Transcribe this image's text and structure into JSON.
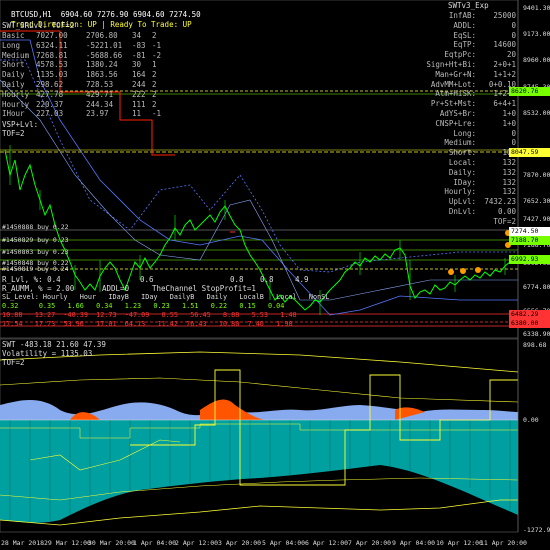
{
  "header": {
    "symbol_line": "BTCUSD,H1  6904.60 7276.90 6904.60 7274.50",
    "trend_label": "Trend Direction: ",
    "trend_value": "UP",
    "ready_label": "| Ready To Trade: ",
    "ready_value": "UP",
    "indicator_name": "SWTv3_Exp",
    "srlvl_label": "SWT_SRLvl: TOF=2"
  },
  "left_table": {
    "rows": [
      {
        "name": "Basic",
        "v1": "7027.00",
        "v2": "2706.80",
        "v3": "34",
        "v4": "2"
      },
      {
        "name": "Long",
        "v1": "6324.11",
        "v2": "-5221.01",
        "v3": "-83",
        "v4": "-1"
      },
      {
        "name": "Medium",
        "v1": "7268.81",
        "v2": "-5688.66",
        "v3": "-81",
        "v4": "-2"
      },
      {
        "name": "Short",
        "v1": "4578.53",
        "v2": "1380.24",
        "v3": "30",
        "v4": "1"
      },
      {
        "name": "Daily",
        "v1": "1135.03",
        "v2": "1863.56",
        "v3": "164",
        "v4": "2"
      },
      {
        "name": "Daily",
        "v1": "298.62",
        "v2": "728.53",
        "v3": "244",
        "v4": "2"
      },
      {
        "name": "Hourly",
        "v1": "427.78",
        "v2": "429.71",
        "v3": "222",
        "v4": "2"
      },
      {
        "name": "Hourly",
        "v1": "220.37",
        "v2": "244.34",
        "v3": "111",
        "v4": "2"
      },
      {
        "name": "IHour",
        "v1": "227.03",
        "v2": "23.97",
        "v3": "11",
        "v4": "-1"
      }
    ],
    "vsp_label": "VSP+Lvl:",
    "tof_label": "TOF=2"
  },
  "right_table": {
    "rows": [
      {
        "k": "InfAB:",
        "v": "25000"
      },
      {
        "k": "ADDL:",
        "v": "0"
      },
      {
        "k": "EqSL:",
        "v": "0"
      },
      {
        "k": "EqTP:",
        "v": "14600"
      },
      {
        "k": "EqtpPc:",
        "v": "20"
      },
      {
        "k": "Sign+Ht+Bi:",
        "v": "2+0+1"
      },
      {
        "k": "Man+Gr+N:",
        "v": "1+1+2"
      },
      {
        "k": "AdvMM+Lot:",
        "v": "0+0.10"
      },
      {
        "k": "Atm+HiSK:",
        "v": "1+2+0"
      },
      {
        "k": "Pr+St+Mst:",
        "v": "6+4+1"
      },
      {
        "k": "AdYS+Br:",
        "v": "1+0"
      },
      {
        "k": "CNSP+Lre:",
        "v": "1+0"
      },
      {
        "k": "Long:",
        "v": "0"
      },
      {
        "k": "Medium:",
        "v": "0"
      },
      {
        "k": "Short:",
        "v": "108"
      },
      {
        "k": "Local:",
        "v": "132"
      },
      {
        "k": "Daily:",
        "v": "132"
      },
      {
        "k": "IDay:",
        "v": "132"
      },
      {
        "k": "Hourly:",
        "v": "132"
      },
      {
        "k": "UpLvl:",
        "v": "7432.23"
      },
      {
        "k": "DnLvl:",
        "v": "0.00"
      },
      {
        "k": "",
        "v": "TOF=2"
      }
    ]
  },
  "buy_labels": [
    "#1450888 buy 0.22",
    "#1450829 buy 0.23",
    "#1450803 buy 0.23",
    "#1450848 buy 0.22",
    "#1450819 buy 0.24"
  ],
  "lower_info": {
    "r_line": "R_Lvl, %: 0.4",
    "r_aumm": "R_AUMM, % = 2.00",
    "addl": "ADDL=0",
    "channel": "TheChannel StopProfit=1",
    "levels_header": "SL_Level: Hourly   Hour   IDayB   IDay   DailyB   Daily   LocalB   Local   NonSL",
    "levels_row1": "0.32     0.35   1.66   0.34   1.23   0.23   1.51   0.22   0.15   0.04",
    "levels_row2": "10.88   13.27  -40.39  12.73  -47.09   8.55   56.45   8.88   5.53   1.48",
    "levels_row3": "17.54   17.73  53.96   17.01  64.13   11.42  76.43   10.80  7.40   1.98",
    "axis_marks": [
      "0.6",
      "0.8",
      "0.8",
      "4.9"
    ]
  },
  "price_axis": [
    "9401.30",
    "9173.00",
    "8960.00",
    "8745.30",
    "8532.00",
    "8047.59",
    "7870.00",
    "7652.30",
    "7427.90",
    "7274.50",
    "7188.70",
    "6992.93",
    "6774.80",
    "6556.70",
    "6482.29",
    "6338.90"
  ],
  "price_tags": [
    {
      "label": "8620.76",
      "color": "#7f0"
    },
    {
      "label": "8047.59",
      "color": "#ff3"
    },
    {
      "label": "7274.50",
      "color": "#fff"
    },
    {
      "label": "7188.70",
      "color": "#7f0"
    },
    {
      "label": "6992.93",
      "color": "#7f0"
    },
    {
      "label": "6482.29",
      "color": "#f33"
    },
    {
      "label": "6380.00",
      "color": "#f33"
    }
  ],
  "subwindow": {
    "header": "SWT -483.18 21.60 47.39",
    "volatility": "Volatility = 1135.03",
    "tof": "TOF=2",
    "axis": [
      "898.68",
      "0.00",
      "-1272.99"
    ]
  },
  "time_axis": [
    "28 Mar 2018",
    "29 Mar 12:00",
    "30 Mar 20:00",
    "1 Apr 04:00",
    "2 Apr 12:00",
    "3 Apr 20:00",
    "5 Apr 04:00",
    "6 Apr 12:00",
    "7 Apr 20:00",
    "9 Apr 04:00",
    "10 Apr 12:00",
    "11 Apr 20:00"
  ],
  "colors": {
    "candle": "#00ff00",
    "trend": "#ffff33",
    "channel": "#5577ff",
    "red_line": "#ff2200",
    "fill_orange": "#ff5500",
    "fill_blue": "#88aaee",
    "hist": "#00a0a0"
  }
}
